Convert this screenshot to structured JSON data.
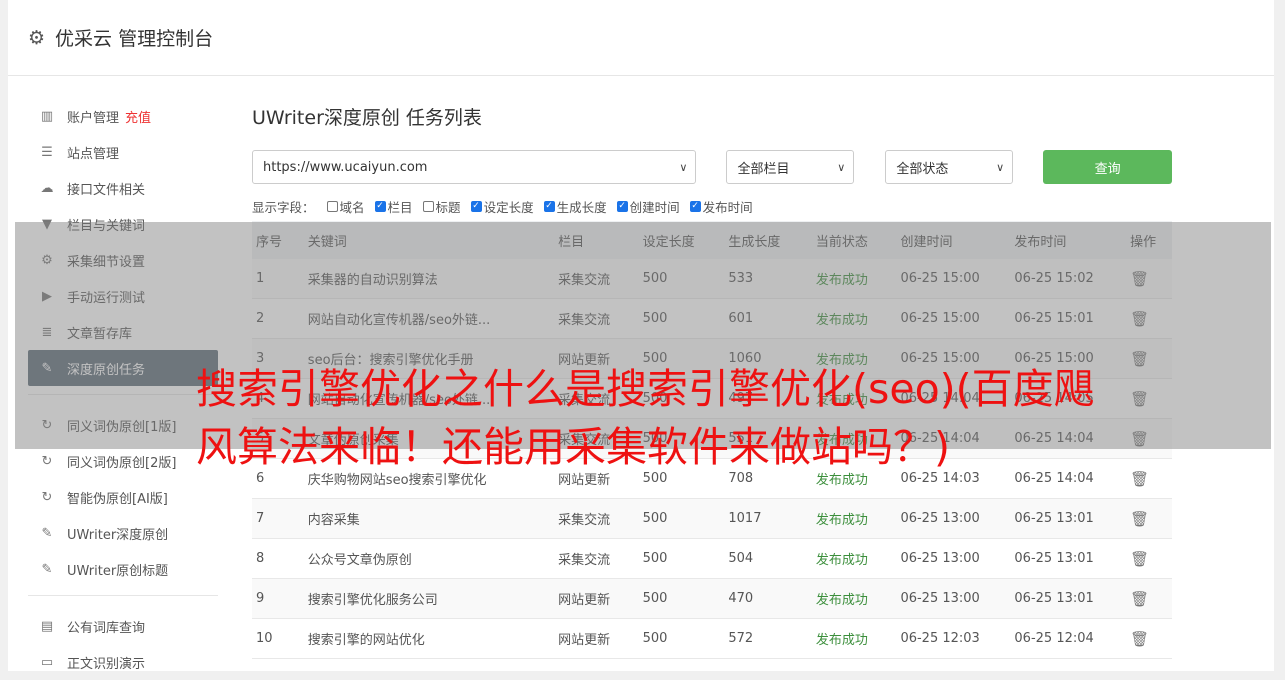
{
  "app": {
    "title": "优采云 管理控制台",
    "icon": "gear-icon"
  },
  "sidebar": {
    "groups": [
      [
        {
          "label": "账户管理",
          "badge": "充值",
          "icon": "bar-chart-icon",
          "glyph": "▥"
        },
        {
          "label": "站点管理",
          "icon": "server-icon",
          "glyph": "☰"
        },
        {
          "label": "接口文件相关",
          "icon": "cloud-upload-icon",
          "glyph": "☁"
        },
        {
          "label": "栏目与关键词",
          "icon": "filter-icon",
          "glyph": "▼"
        },
        {
          "label": "采集细节设置",
          "icon": "gears-icon",
          "glyph": "⚙"
        },
        {
          "label": "手动运行测试",
          "icon": "play-icon",
          "glyph": "▶"
        },
        {
          "label": "文章暂存库",
          "icon": "database-icon",
          "glyph": "≣"
        },
        {
          "label": "深度原创任务",
          "icon": "edit-icon",
          "glyph": "✎",
          "active": true
        }
      ],
      [
        {
          "label": "同义词伪原创[1版]",
          "icon": "refresh-icon",
          "glyph": "↻"
        },
        {
          "label": "同义词伪原创[2版]",
          "icon": "refresh-icon",
          "glyph": "↻"
        },
        {
          "label": "智能伪原创[AI版]",
          "icon": "refresh-icon",
          "glyph": "↻"
        },
        {
          "label": "UWriter深度原创",
          "icon": "edit-icon",
          "glyph": "✎"
        },
        {
          "label": "UWriter原创标题",
          "icon": "edit-icon",
          "glyph": "✎"
        }
      ],
      [
        {
          "label": "公有词库查询",
          "icon": "book-icon",
          "glyph": "▤"
        },
        {
          "label": "正文识别演示",
          "icon": "monitor-icon",
          "glyph": "▭"
        }
      ]
    ]
  },
  "main": {
    "title": "UWriter深度原创 任务列表",
    "filters": {
      "site": "https://www.ucaiyun.com",
      "column": "全部栏目",
      "status": "全部状态",
      "query_label": "查询"
    },
    "fields_label": "显示字段：",
    "fields": [
      {
        "label": "域名",
        "checked": false
      },
      {
        "label": "栏目",
        "checked": true
      },
      {
        "label": "标题",
        "checked": false
      },
      {
        "label": "设定长度",
        "checked": true
      },
      {
        "label": "生成长度",
        "checked": true
      },
      {
        "label": "创建时间",
        "checked": true
      },
      {
        "label": "发布时间",
        "checked": true
      }
    ],
    "table": {
      "headers": [
        "序号",
        "关键词",
        "栏目",
        "设定长度",
        "生成长度",
        "当前状态",
        "创建时间",
        "发布时间",
        "操作"
      ],
      "rows": [
        [
          "1",
          "采集器的自动识别算法",
          "采集交流",
          "500",
          "533",
          "发布成功",
          "06-25 15:00",
          "06-25 15:02"
        ],
        [
          "2",
          "网站自动化宣传机器/seo外链...",
          "采集交流",
          "500",
          "601",
          "发布成功",
          "06-25 15:00",
          "06-25 15:01"
        ],
        [
          "3",
          "seo后台：搜索引擎优化手册",
          "网站更新",
          "500",
          "1060",
          "发布成功",
          "06-25 15:00",
          "06-25 15:00"
        ],
        [
          "4",
          "网站自动化宣传机器/seo外链...",
          "采集交流",
          "500",
          "497",
          "发布成功",
          "06-25 14:04",
          "06-25 14:05"
        ],
        [
          "5",
          "文章伪原创采集",
          "采集交流",
          "500",
          "551",
          "发布成功",
          "06-25 14:04",
          "06-25 14:04"
        ],
        [
          "6",
          "庆华购物网站seo搜索引擎优化",
          "网站更新",
          "500",
          "708",
          "发布成功",
          "06-25 14:03",
          "06-25 14:04"
        ],
        [
          "7",
          "内容采集",
          "采集交流",
          "500",
          "1017",
          "发布成功",
          "06-25 13:00",
          "06-25 13:01"
        ],
        [
          "8",
          "公众号文章伪原创",
          "采集交流",
          "500",
          "504",
          "发布成功",
          "06-25 13:00",
          "06-25 13:01"
        ],
        [
          "9",
          "搜索引擎优化服务公司",
          "网站更新",
          "500",
          "470",
          "发布成功",
          "06-25 13:00",
          "06-25 13:01"
        ],
        [
          "10",
          "搜索引擎的网站优化",
          "网站更新",
          "500",
          "572",
          "发布成功",
          "06-25 12:03",
          "06-25 12:04"
        ]
      ]
    }
  },
  "overlay": {
    "headline": "搜索引擎优化之什么是搜索引擎优化(seo)(百度飓风算法来临！还能用采集软件来做站吗？)",
    "color": "#ee1111"
  },
  "colors": {
    "active_nav": "#5f6d7a",
    "query_button": "#5cb85c",
    "success": "#3c8f3c",
    "recharge": "#ee3333"
  }
}
